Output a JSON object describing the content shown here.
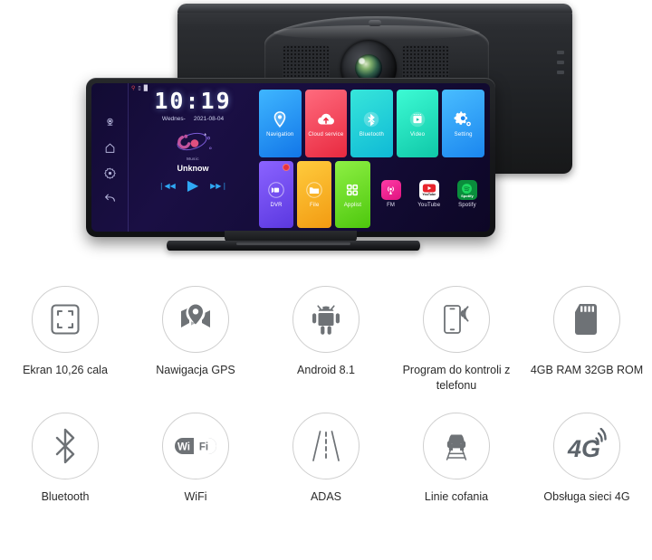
{
  "device": {
    "screen": {
      "clock": "10:19",
      "weekday": "Wednes-",
      "date": "2021-08-04",
      "music_caption": "Music",
      "track_title": "Unknow",
      "prev_label": "❘◀◀",
      "play_label": "▶",
      "next_label": "▶▶❘",
      "rail_icons": [
        "voice-assistant-icon",
        "home-icon",
        "settings-icon",
        "back-icon"
      ],
      "status_icons": [
        "gps-off-icon",
        "sim-icon",
        "signal-icon"
      ],
      "tiles_row1": [
        {
          "label": "Navigation",
          "icon": "map-pin-icon",
          "color": "#1e9bf0"
        },
        {
          "label": "Cloud service",
          "icon": "cloud-upload-icon",
          "color": "#f0455e"
        },
        {
          "label": "Bluetooth",
          "icon": "bluetooth-icon",
          "color": "#1ad3c8"
        },
        {
          "label": "Video",
          "icon": "video-play-icon",
          "color": "#17d6b6"
        },
        {
          "label": "Setting",
          "icon": "gear-icon",
          "color": "#2aa7f2"
        }
      ],
      "tiles_row2": [
        {
          "label": "DVR",
          "icon": "dvr-camera-icon",
          "color": "#6d4ef0",
          "badge": true
        },
        {
          "label": "File",
          "icon": "folder-icon",
          "color": "#f8b525",
          "badge": false
        },
        {
          "label": "Applist",
          "icon": "grid-apps-icon",
          "color": "#6fd926",
          "badge": false
        },
        {
          "label": "FM",
          "icon": "radio-tower-icon",
          "color": "#ec1a8e",
          "badge": false
        },
        {
          "label": "YouTube",
          "icon": "youtube-icon",
          "color": "#ffffff",
          "badge": false
        },
        {
          "label": "Spotify",
          "icon": "spotify-icon",
          "color": "#0a8d3c",
          "badge": false
        }
      ],
      "youtube_wordmark": "YouTube",
      "spotify_wordmark": "Spotify"
    }
  },
  "features": {
    "row1": [
      {
        "label": "Ekran 10,26 cala",
        "icon": "screen-size-icon"
      },
      {
        "label": "Nawigacja GPS",
        "icon": "map-pin-icon"
      },
      {
        "label": "Android 8.1",
        "icon": "android-robot-icon"
      },
      {
        "label": "Program do kontroli\nz telefonu",
        "icon": "phone-wireless-icon"
      },
      {
        "label": "4GB RAM\n32GB ROM",
        "icon": "sd-card-icon"
      }
    ],
    "row2": [
      {
        "label": "Bluetooth",
        "icon": "bluetooth-icon"
      },
      {
        "label": "WiFi",
        "icon": "wifi-badge-icon",
        "wordmark_a": "Wi",
        "wordmark_b": "Fi"
      },
      {
        "label": "ADAS",
        "icon": "road-lanes-icon"
      },
      {
        "label": "Linie cofania",
        "icon": "reverse-guidelines-icon"
      },
      {
        "label": "Obsługa sieci 4G",
        "icon": "four-g-signal-icon",
        "wordmark": "4G"
      }
    ]
  },
  "colors": {
    "icon_gray": "#6e7276",
    "circle_stroke": "#cfcfcf",
    "text": "#2b2b2b",
    "background": "#ffffff"
  }
}
